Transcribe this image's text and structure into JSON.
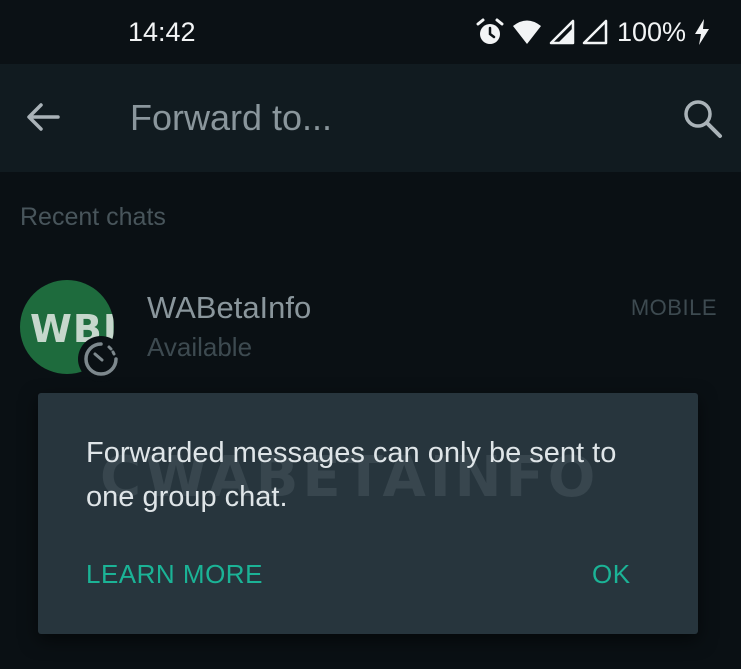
{
  "status_bar": {
    "time": "14:42",
    "battery": "100%",
    "icons": [
      "alarm-icon",
      "wifi-icon",
      "signal-icon",
      "signal-icon",
      "battery-charging-icon"
    ]
  },
  "app_bar": {
    "back_icon": "arrow-left-icon",
    "search_placeholder": "Forward to...",
    "search_icon": "search-icon"
  },
  "recent_header": "Recent chats",
  "chats": [
    {
      "avatar_text": "WBI",
      "name": "WABetaInfo",
      "status": "Available",
      "tag": "MOBILE"
    }
  ],
  "dialog": {
    "message": "Forwarded messages can only be sent to one group chat.",
    "watermark": "CWABETAINFO",
    "learn_more": "LEARN MORE",
    "ok": "OK"
  },
  "colors": {
    "accent": "#1bb396",
    "dialog_bg": "#27353d",
    "app_bar_bg": "#111b20",
    "background": "#0a1014",
    "avatar_bg": "#1e6b3d"
  }
}
